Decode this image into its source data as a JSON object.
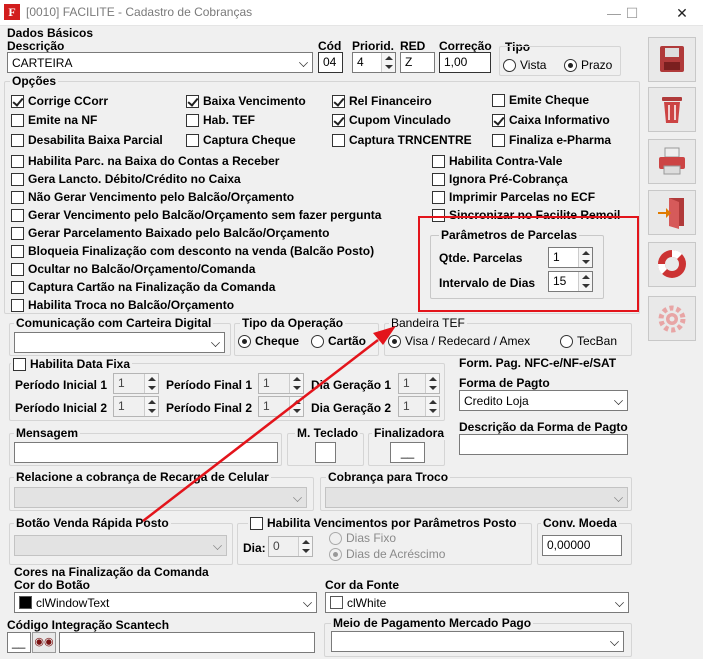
{
  "window": {
    "title": "[0010] FACILITE - Cadastro de Cobranças",
    "icon_letter": "F",
    "minimize": "—",
    "maximize": "☐",
    "close": "✕"
  },
  "dados": {
    "section": "Dados Básicos",
    "descricao_label": "Descrição",
    "descricao_value": "CARTEIRA",
    "cod_label": "Cód",
    "cod_value": "04",
    "priorid_label": "Priorid.",
    "priorid_value": "4",
    "red_label": "RED",
    "red_value": "Z",
    "correcao_label": "Correção",
    "correcao_value": "1,00",
    "tipo_label": "Tipo",
    "tipo_vista": "Vista",
    "tipo_prazo": "Prazo"
  },
  "opcoes": {
    "section": "Opções",
    "corrige": "Corrige CCorr",
    "baixa": "Baixa Vencimento",
    "relfin": "Rel Financeiro",
    "emitecheque": "Emite Cheque",
    "emitenf": "Emite na NF",
    "habtef": "Hab. TEF",
    "cupom": "Cupom Vinculado",
    "caixainf": "Caixa Informativo",
    "desabilita": "Desabilita Baixa Parcial",
    "capcheque": "Captura Cheque",
    "captrn": "Captura TRNCENTRE",
    "finaliza": "Finaliza e-Pharma",
    "habparc": "Habilita Parc. na Baixa do Contas a Receber",
    "geralancto": "Gera Lancto. Débito/Crédito no Caixa",
    "naogerar": "Não Gerar Vencimento pelo Balcão/Orçamento",
    "gerarsem": "Gerar Vencimento pelo Balcão/Orçamento sem fazer pergunta",
    "gerarparc": "Gerar Parcelamento Baixado pelo Balcão/Orçamento",
    "bloqueia": "Bloqueia Finalização com desconto na venda (Balcão Posto)",
    "ocultar": "Ocultar no Balcão/Orçamento/Comanda",
    "capcartao": "Captura Cartão na Finalização da Comanda",
    "habtroca": "Habilita Troca no Balcão/Orçamento",
    "habcontravale": "Habilita Contra-Vale",
    "ignora": "Ignora Pré-Cobrança",
    "imprimir": "Imprimir Parcelas no ECF",
    "sincronizar": "Sincronizar no Facilite Remoil"
  },
  "parametros": {
    "title": "Parâmetros de Parcelas",
    "qtde_label": "Qtde. Parcelas",
    "qtde_value": "1",
    "intervalo_label": "Intervalo de Dias",
    "intervalo_value": "15"
  },
  "comunicacao": {
    "label": "Comunicação com Carteira Digital",
    "value": ""
  },
  "tipo_operacao": {
    "label": "Tipo da Operação",
    "cheque": "Cheque",
    "cartao": "Cartão"
  },
  "bandeira": {
    "label": "Bandeira TEF",
    "visa": "Visa / Redecard / Amex",
    "tecban": "TecBan"
  },
  "datafixa": {
    "habilita": "Habilita Data Fixa",
    "pi1": "Período Inicial 1",
    "pf1": "Período Final 1",
    "dg1": "Dia Geração 1",
    "pi2": "Período Inicial 2",
    "pf2": "Período Final 2",
    "dg2": "Dia Geração 2",
    "v1": "1",
    "v2": "1",
    "v3": "1",
    "v4": "1",
    "v5": "1",
    "v6": "1"
  },
  "formpag": {
    "title": "Form. Pag. NFC-e/NF-e/SAT",
    "forma_label": "Forma de Pagto",
    "forma_value": "Credito Loja",
    "desc_label": "Descrição da Forma de Pagto",
    "desc_value": ""
  },
  "mensagem": {
    "label": "Mensagem",
    "value": "",
    "mteclado": "M. Teclado",
    "finalizadora": "Finalizadora",
    "finalizadora_value": "__"
  },
  "recarga": {
    "label": "Relacione a cobrança de Recarga de Celular",
    "troco": "Cobrança para Troco"
  },
  "botaovenda": {
    "label": "Botão Venda Rápida Posto",
    "habilita": "Habilita Vencimentos por Parâmetros Posto",
    "dia": "Dia:",
    "dia_value": "0",
    "diasfixo": "Dias Fixo",
    "diasacrescimo": "Dias de Acréscimo",
    "convmoeda": "Conv. Moeda",
    "convmoeda_value": "0,00000"
  },
  "cores": {
    "title": "Cores na Finalização da Comanda",
    "botao_label": "Cor do Botão",
    "botao_value": "clWindowText",
    "botao_color": "#000000",
    "fonte_label": "Cor da Fonte",
    "fonte_value": "clWhite",
    "fonte_color": "#ffffff"
  },
  "scantech": {
    "label": "Código Integração Scantech",
    "value": "__"
  },
  "mercadopago": {
    "label": "Meio de Pagamento Mercado Pago",
    "value": ""
  },
  "annotation": {
    "box_color": "#e3141b",
    "arrow_color": "#e3141b"
  },
  "sidebar": [
    "save-icon",
    "trash-icon",
    "printer-icon",
    "exit-door-icon",
    "lifebuoy-icon",
    "gear-icon"
  ]
}
